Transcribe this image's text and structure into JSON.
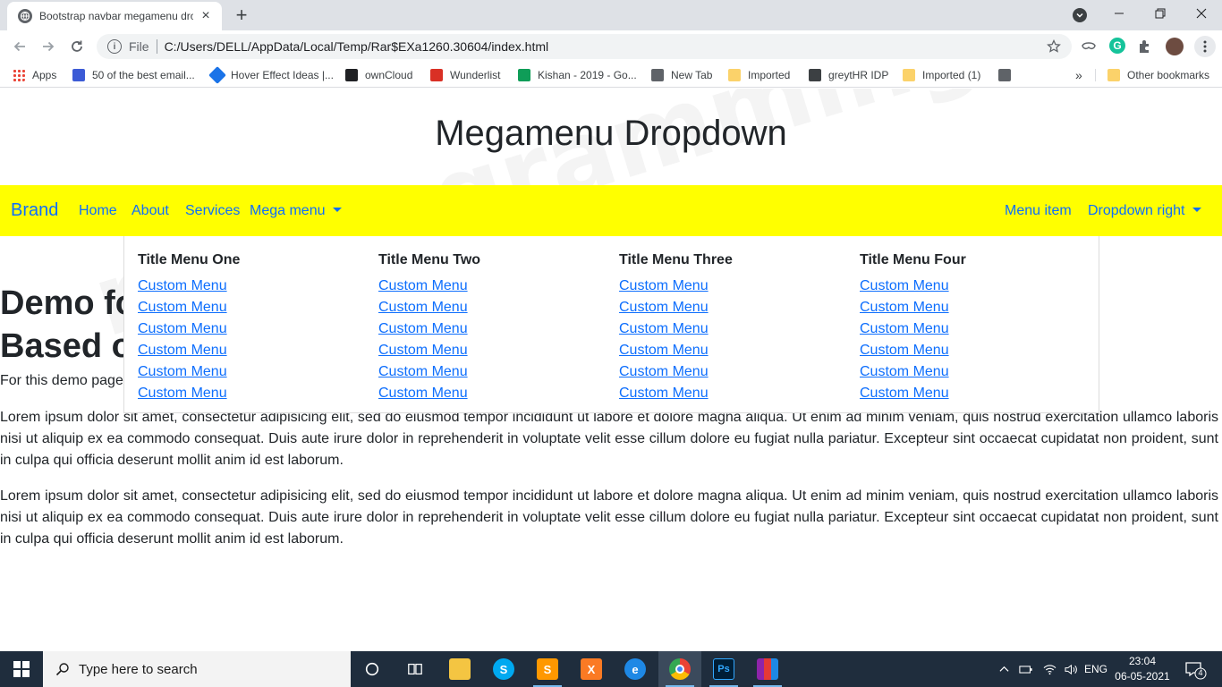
{
  "browser": {
    "tab_title": "Bootstrap navbar megamenu dro",
    "url_scheme": "File",
    "url": "C:/Users/DELL/AppData/Local/Temp/Rar$EXa1260.30604/index.html",
    "bookmarks": [
      {
        "label": "Apps",
        "icon": "apps-grid-icon"
      },
      {
        "label": "50 of the best email...",
        "icon": "c-logo-icon"
      },
      {
        "label": "Hover Effect Ideas |...",
        "icon": "drop-icon"
      },
      {
        "label": "ownCloud",
        "icon": "cloud-icon"
      },
      {
        "label": "Wunderlist",
        "icon": "wunderlist-icon"
      },
      {
        "label": "Kishan - 2019 - Go...",
        "icon": "plus-icon"
      },
      {
        "label": "New Tab",
        "icon": "globe-icon"
      },
      {
        "label": "Imported",
        "icon": "folder-icon"
      },
      {
        "label": "greytHR IDP",
        "icon": "greythr-icon"
      },
      {
        "label": "Imported (1)",
        "icon": "folder-icon"
      },
      {
        "label": "",
        "icon": "globe-icon"
      }
    ],
    "bookmarks_overflow": "»",
    "other_bookmarks": "Other bookmarks"
  },
  "page": {
    "heading": "Megamenu Dropdown",
    "navbar": {
      "brand": "Brand",
      "left_links": [
        "Home",
        "About",
        "Services",
        "Mega menu"
      ],
      "right_links": [
        "Menu item",
        "Dropdown right"
      ],
      "background": "#ffff00",
      "link_color": "#0d6efd"
    },
    "megamenu": {
      "columns": [
        {
          "title": "Title Menu One",
          "items": [
            "Custom Menu",
            "Custom Menu",
            "Custom Menu",
            "Custom Menu",
            "Custom Menu",
            "Custom Menu"
          ]
        },
        {
          "title": "Title Menu Two",
          "items": [
            "Custom Menu",
            "Custom Menu",
            "Custom Menu",
            "Custom Menu",
            "Custom Menu",
            "Custom Menu"
          ]
        },
        {
          "title": "Title Menu Three",
          "items": [
            "Custom Menu",
            "Custom Menu",
            "Custom Menu",
            "Custom Menu",
            "Custom Menu",
            "Custom Menu"
          ]
        },
        {
          "title": "Title Menu Four",
          "items": [
            "Custom Menu",
            "Custom Menu",
            "Custom Menu",
            "Custom Menu",
            "Custom Menu",
            "Custom Menu"
          ]
        }
      ]
    },
    "demo_title_line1": "Demo fo",
    "demo_title_line2": "Based o",
    "demo_note": "For this demo page",
    "paragraphs": [
      "Lorem ipsum dolor sit amet, consectetur adipisicing elit, sed do eiusmod tempor incididunt ut labore et dolore magna aliqua. Ut enim ad minim veniam, quis nostrud exercitation ullamco laboris nisi ut aliquip ex ea commodo consequat. Duis aute irure dolor in reprehenderit in voluptate velit esse cillum dolore eu fugiat nulla pariatur. Excepteur sint occaecat cupidatat non proident, sunt in culpa qui officia deserunt mollit anim id est laborum.",
      "Lorem ipsum dolor sit amet, consectetur adipisicing elit, sed do eiusmod tempor incididunt ut labore et dolore magna aliqua. Ut enim ad minim veniam, quis nostrud exercitation ullamco laboris nisi ut aliquip ex ea commodo consequat. Duis aute irure dolor in reprehenderit in voluptate velit esse cillum dolore eu fugiat nulla pariatur. Excepteur sint occaecat cupidatat non proident, sunt in culpa qui officia deserunt mollit anim id est laborum."
    ],
    "watermark": "myprogramming.com"
  },
  "taskbar": {
    "search_placeholder": "Type here to search",
    "language": "ENG",
    "time": "23:04",
    "date": "06-05-2021",
    "notification_count": "4"
  }
}
